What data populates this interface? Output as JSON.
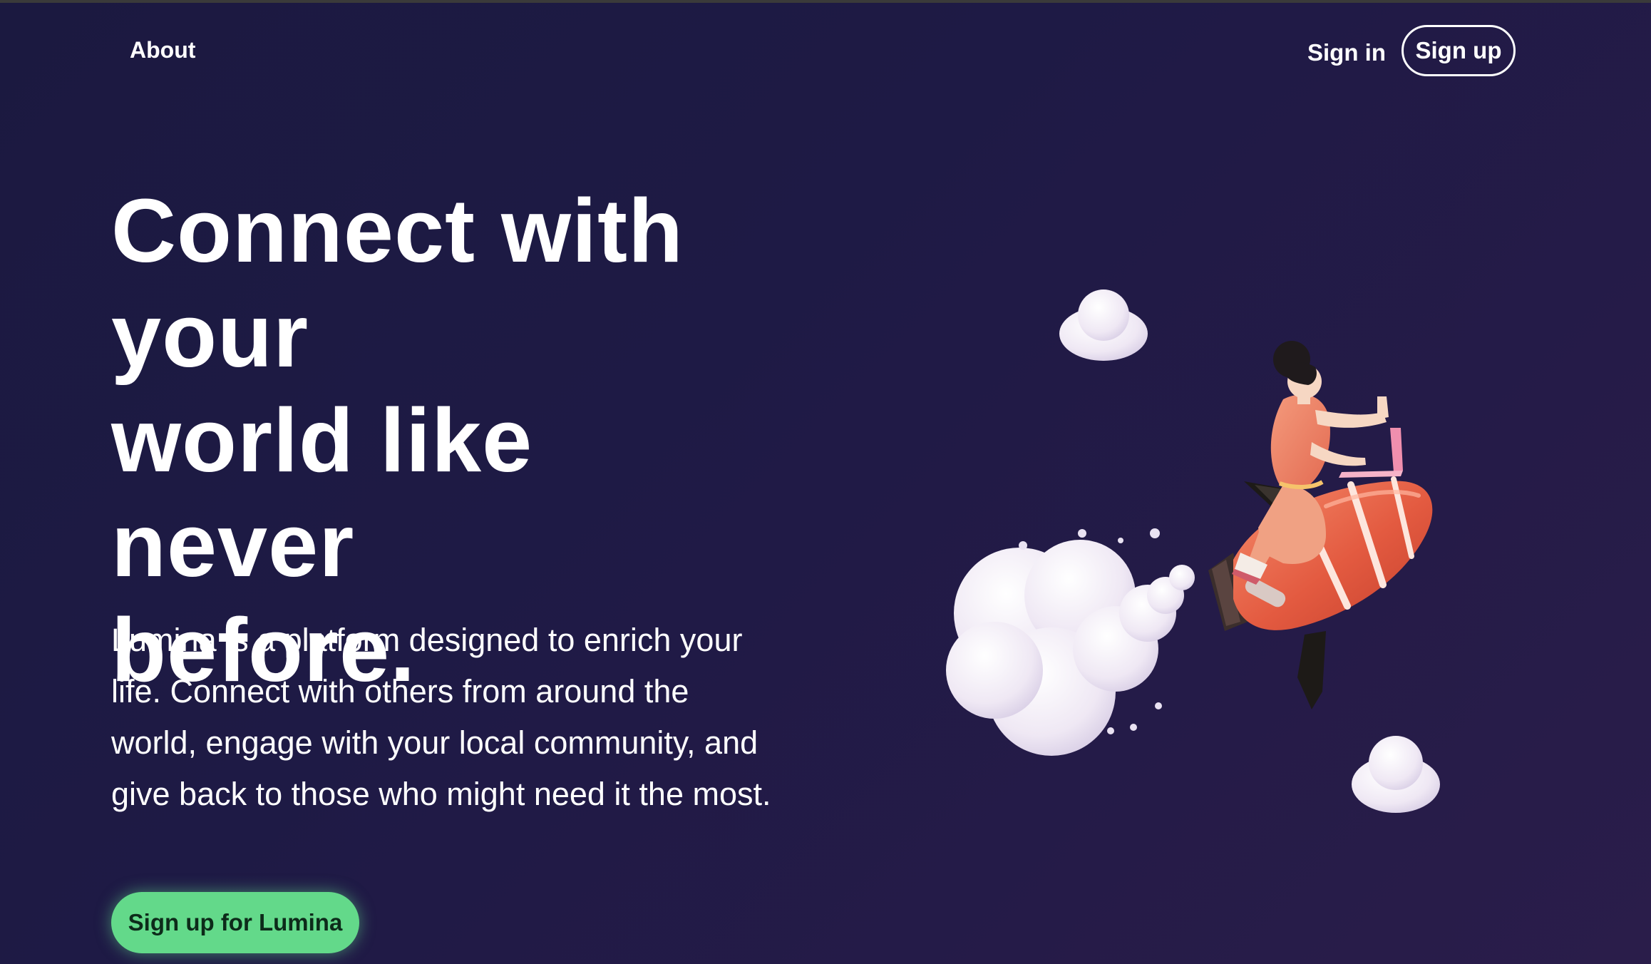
{
  "header": {
    "about_label": "About",
    "sign_in_label": "Sign in",
    "sign_up_label": "Sign up"
  },
  "hero": {
    "title_lines": [
      "Connect with",
      "your",
      "world like never",
      "before."
    ],
    "description": "Lumina is a platform designed to enrich your life. Connect with others from around the world, engage with your local community, and give back to those who might need it the most.",
    "cta_label": "Sign up for Lumina"
  },
  "illustration": {
    "icon": "woman-riding-rocket-illustration",
    "rocket_color": "#e8684e",
    "cloud_color": "#f3eef7"
  },
  "colors": {
    "background": "#1e1a45",
    "accent_green": "#63d98a",
    "text": "#ffffff"
  }
}
